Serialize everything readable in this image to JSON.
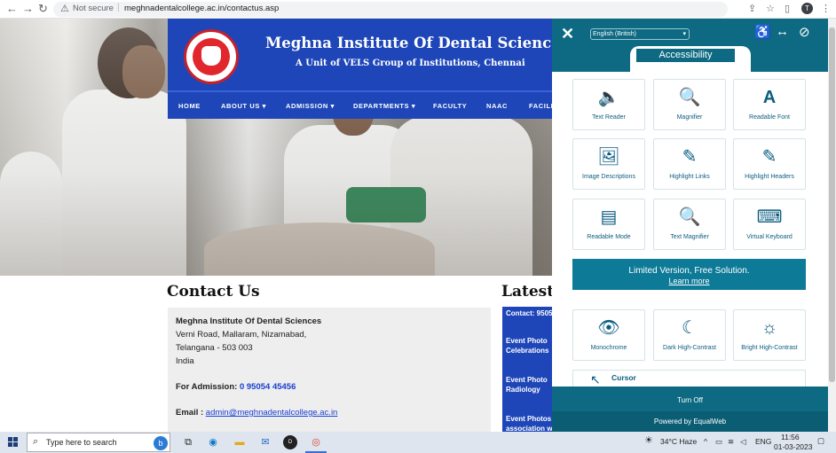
{
  "browser": {
    "security_label": "Not secure",
    "url": "meghnadentalcollege.ac.in/contactus.asp",
    "profile_initial": "T"
  },
  "site": {
    "title": "Meghna Institute Of Dental Sciences",
    "subtitle": "A Unit of VELS Group of Institutions, Chennai",
    "menu": [
      "HOME",
      "ABOUT US",
      "ADMISSION",
      "DEPARTMENTS",
      "FACULTY",
      "NAAC",
      "FACILI"
    ],
    "contact_heading": "Contact Us",
    "latest_heading": "Latest N",
    "address": {
      "name": "Meghna Institute Of Dental Sciences",
      "line1": "Verni Road, Mallaram, Nizamabad,",
      "line2": "Telangana - 503 003",
      "line3": "India",
      "admission_label": "For Admission: ",
      "admission_phone": "0 95054 45456",
      "email_label": "Email : ",
      "email": "admin@meghnadentalcollege.ac.in"
    },
    "news": [
      "Contact: 9505",
      "Event     Photo",
      "Celebrations",
      "Event     Photo",
      "Radiology",
      "Event    Photos",
      "association wi"
    ]
  },
  "accessibility": {
    "language": "English (British)",
    "tab_label": "Accessibility",
    "tiles_top": [
      "Text Reader",
      "Magnifier",
      "Readable Font",
      "Image Descriptions",
      "Highlight Links",
      "Highlight Headers",
      "Readable Mode",
      "Text Magnifier",
      "Virtual Keyboard"
    ],
    "promo_text": "Limited Version, Free Solution.",
    "promo_link": "Learn more",
    "tiles_bottom": [
      "Monochrome",
      "Dark High-Contrast",
      "Bright High-Contrast"
    ],
    "cursor_label": "Cursor",
    "turn_off": "Turn Off",
    "powered_by": "Powered by EqualWeb"
  },
  "taskbar": {
    "search_placeholder": "Type here to search",
    "weather": "34°C  Haze",
    "language": "ENG",
    "time": "11:56",
    "date": "01-03-2023"
  }
}
